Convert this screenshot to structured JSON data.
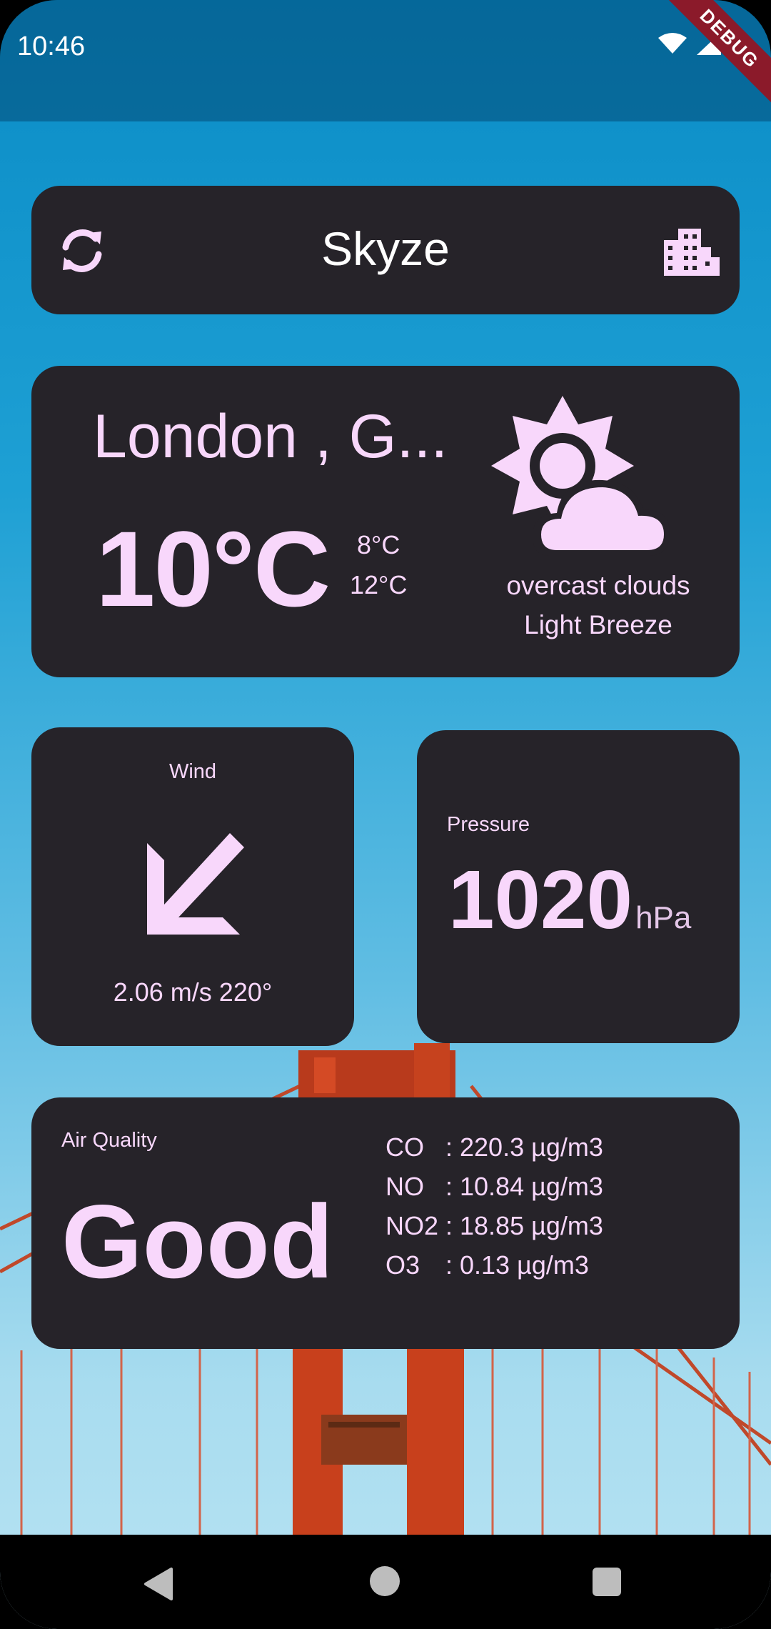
{
  "status_bar": {
    "time": "10:46",
    "debug_banner": "DEBUG"
  },
  "app_bar": {
    "title": "Skyze",
    "left_icon": "refresh-icon",
    "right_icon": "city-icon"
  },
  "current": {
    "location": "London , G...",
    "temperature": "10°C",
    "temp_min": "8°C",
    "temp_max": "12°C",
    "icon": "sun-cloud-icon",
    "description": "overcast clouds",
    "wind_description": "Light Breeze"
  },
  "wind": {
    "label": "Wind",
    "value": "2.06 m/s 220°",
    "direction_deg": 220
  },
  "pressure": {
    "label": "Pressure",
    "value": "1020",
    "unit": "hPa"
  },
  "air_quality": {
    "label": "Air Quality",
    "rating": "Good",
    "pollutants": [
      {
        "name": "CO",
        "value": ": 220.3 µg/m3"
      },
      {
        "name": "NO",
        "value": ": 10.84 µg/m3"
      },
      {
        "name": "NO2",
        "value": ": 18.85 µg/m3"
      },
      {
        "name": "O3",
        "value": ": 0.13 µg/m3"
      }
    ]
  },
  "colors": {
    "card": "#262329",
    "accent": "#f8d7fb",
    "sky": "#1ea0d4",
    "bridge": "#c8401c"
  }
}
